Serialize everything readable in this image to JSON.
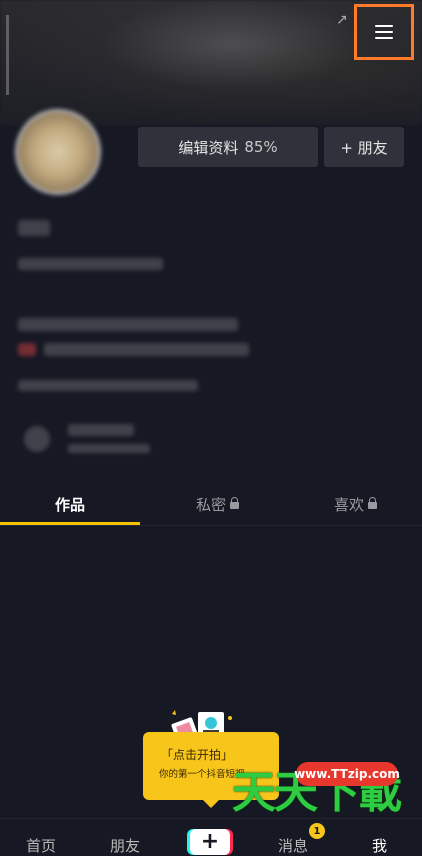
{
  "profile": {
    "edit_label": "编辑资料",
    "edit_percent": "85%",
    "add_friend_label": "+ 朋友"
  },
  "tabs": {
    "works": "作品",
    "private": "私密",
    "likes": "喜欢"
  },
  "tooltip": {
    "line1": "「点击开拍」",
    "line2": "你的第一个抖音短视"
  },
  "watermark": {
    "url": "www.TTzip.com",
    "text": "天天下載"
  },
  "bottom_nav": {
    "home": "首页",
    "friends": "朋友",
    "create": "+",
    "inbox": "消息",
    "inbox_badge": "1",
    "me": "我"
  },
  "colors": {
    "accent": "#f5c200",
    "highlight_box": "#ff7a2b",
    "background": "#161823"
  }
}
